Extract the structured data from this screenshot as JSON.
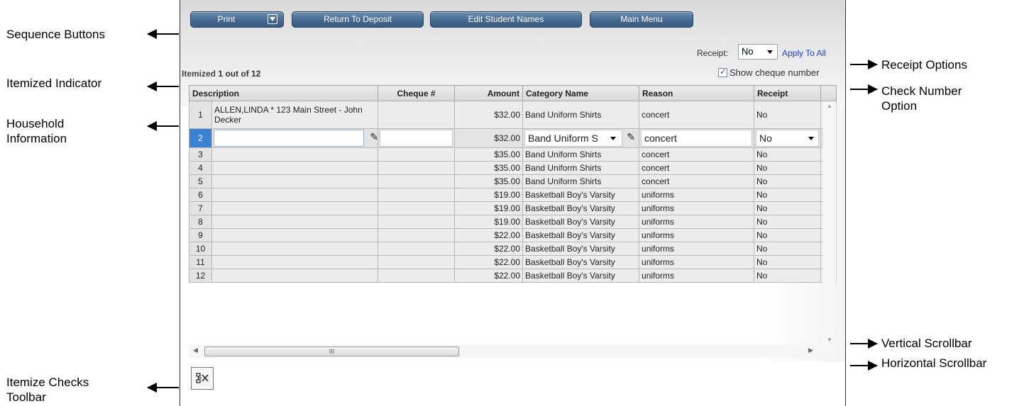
{
  "callouts": {
    "sequence_buttons": "Sequence Buttons",
    "itemized_indicator": "Itemized Indicator",
    "household_information": "Household Information",
    "itemize_checks_toolbar": "Itemize Checks Toolbar",
    "receipt_options": "Receipt Options",
    "check_number_option": "Check Number Option",
    "vertical_scrollbar": "Vertical Scrollbar",
    "horizontal_scrollbar": "Horizontal Scrollbar"
  },
  "toolbar": {
    "print_label": "Print",
    "return_label": "Return To Deposit",
    "edit_names_label": "Edit Student Names",
    "main_menu_label": "Main Menu"
  },
  "receipt": {
    "label": "Receipt:",
    "value": "No",
    "apply_all": "Apply To All"
  },
  "itemized": {
    "prefix": "Itemized",
    "count_text": "1 out of 12"
  },
  "show_cheque_label": "Show cheque number",
  "grid": {
    "headers": {
      "description": "Description",
      "cheque": "Cheque #",
      "amount": "Amount",
      "category": "Category Name",
      "reason": "Reason",
      "receipt": "Receipt"
    },
    "rows": [
      {
        "num": "1",
        "description": "ALLEN,LINDA * 123 Main Street - John Decker",
        "cheque": "",
        "amount": "$32.00",
        "category": "Band Uniform Shirts",
        "reason": "concert",
        "receipt": "No"
      },
      {
        "num": "2",
        "description": "",
        "cheque": "",
        "amount": "$32.00",
        "category": "Band Uniform S",
        "reason": "concert",
        "receipt": "No"
      },
      {
        "num": "3",
        "description": "",
        "cheque": "",
        "amount": "$35.00",
        "category": "Band Uniform Shirts",
        "reason": "concert",
        "receipt": "No"
      },
      {
        "num": "4",
        "description": "",
        "cheque": "",
        "amount": "$35.00",
        "category": "Band Uniform Shirts",
        "reason": "concert",
        "receipt": "No"
      },
      {
        "num": "5",
        "description": "",
        "cheque": "",
        "amount": "$35.00",
        "category": "Band Uniform Shirts",
        "reason": "concert",
        "receipt": "No"
      },
      {
        "num": "6",
        "description": "",
        "cheque": "",
        "amount": "$19.00",
        "category": "Basketball Boy's Varsity",
        "reason": "uniforms",
        "receipt": "No"
      },
      {
        "num": "7",
        "description": "",
        "cheque": "",
        "amount": "$19.00",
        "category": "Basketball Boy's Varsity",
        "reason": "uniforms",
        "receipt": "No"
      },
      {
        "num": "8",
        "description": "",
        "cheque": "",
        "amount": "$19.00",
        "category": "Basketball Boy's Varsity",
        "reason": "uniforms",
        "receipt": "No"
      },
      {
        "num": "9",
        "description": "",
        "cheque": "",
        "amount": "$22.00",
        "category": "Basketball Boy's Varsity",
        "reason": "uniforms",
        "receipt": "No"
      },
      {
        "num": "10",
        "description": "",
        "cheque": "",
        "amount": "$22.00",
        "category": "Basketball Boy's Varsity",
        "reason": "uniforms",
        "receipt": "No"
      },
      {
        "num": "11",
        "description": "",
        "cheque": "",
        "amount": "$22.00",
        "category": "Basketball Boy's Varsity",
        "reason": "uniforms",
        "receipt": "No"
      },
      {
        "num": "12",
        "description": "",
        "cheque": "",
        "amount": "$22.00",
        "category": "Basketball Boy's Varsity",
        "reason": "uniforms",
        "receipt": "No"
      }
    ]
  },
  "hscroll_grip": "III",
  "icons": {
    "print_dropdown": "chevron-down-icon",
    "edit": "pencil-icon",
    "itemize_tool": "itemize-checks-icon"
  },
  "colors": {
    "button_blue": "#46698f",
    "selected_row": "#3b83d6",
    "link_blue": "#2040d8"
  }
}
